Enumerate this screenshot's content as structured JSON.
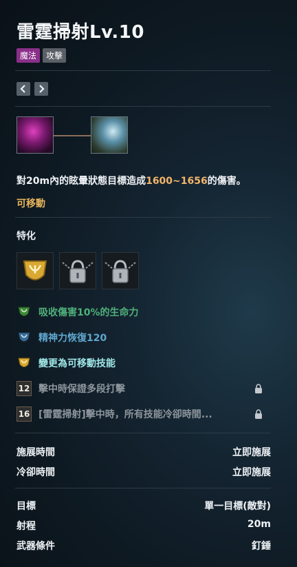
{
  "skill": {
    "title": "雷霆掃射Lv.10",
    "tags": [
      "魔法",
      "攻擊"
    ],
    "description_prefix": "對20m內的眩暈狀態目標造成",
    "description_damage": "1600~1656",
    "description_suffix": "的傷害。",
    "movable_label": "可移動"
  },
  "specialization": {
    "heading": "特化",
    "traits": [
      {
        "label": "吸收傷害10%的生命力",
        "color": "#4fb07a"
      },
      {
        "label": "精神力恢復120",
        "color": "#5fa7cf"
      },
      {
        "label": "變更為可移動技能",
        "color": "#9fe6e6"
      },
      {
        "level": "12",
        "label": "擊中時保證多段打擊",
        "locked": true
      },
      {
        "level": "16",
        "label": "[雷霆掃射]擊中時，所有技能冷卻時間...",
        "locked": true
      }
    ]
  },
  "stats": [
    {
      "key": "施展時間",
      "value": "立即施展"
    },
    {
      "key": "冷卻時間",
      "value": "立即施展"
    },
    {
      "key": "目標",
      "value": "單一目標(敵對)"
    },
    {
      "key": "射程",
      "value": "20m"
    },
    {
      "key": "武器條件",
      "value": "釘錘"
    }
  ],
  "colors": {
    "accent_orange": "#f2b56b",
    "movable_gold": "#e7b45d",
    "tag_magic": "#8a2f8a",
    "tag_attack": "#5a5f66"
  },
  "icons": [
    "prev-arrow-icon",
    "next-arrow-icon",
    "skill-icon",
    "linked-skill-icon",
    "shield-emblem-icon",
    "padlock-icon",
    "small-lock-icon"
  ]
}
